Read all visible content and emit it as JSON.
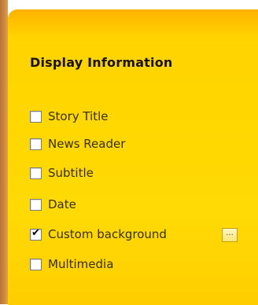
{
  "section": {
    "title": "Display Information"
  },
  "options": [
    {
      "label": "Story Title",
      "checked": false
    },
    {
      "label": "News Reader",
      "checked": false
    },
    {
      "label": "Subtitle",
      "checked": false
    },
    {
      "label": "Date",
      "checked": false
    },
    {
      "label": "Custom background",
      "checked": true
    },
    {
      "label": "Multimedia",
      "checked": false
    }
  ],
  "custom_background_button": {
    "label": "..."
  },
  "colors": {
    "panel": "#ffd600",
    "panel_top": "#ffb400",
    "edge": "#c07a3c",
    "text": "#3a2f10"
  }
}
